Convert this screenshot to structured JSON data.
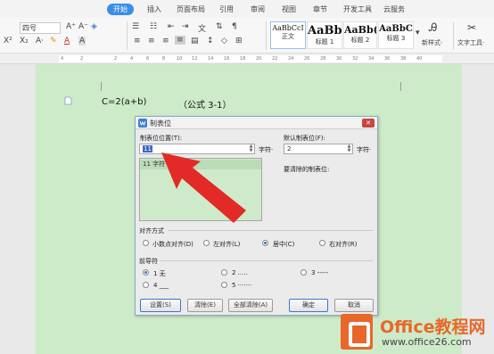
{
  "tabs": {
    "home": "开始",
    "insert": "插入",
    "layout": "页面布局",
    "references": "引用",
    "review": "审阅",
    "view": "视图",
    "section": "章节",
    "developer": "开发工具",
    "cloud": "云服务"
  },
  "ribbon": {
    "font_size": "四号",
    "styles": [
      {
        "preview": "AaBbCcI",
        "name": "正文"
      },
      {
        "preview": "AaBb",
        "name": "标题 1"
      },
      {
        "preview": "AaBb(",
        "name": "标题 2"
      },
      {
        "preview": "AaBbC",
        "name": "标题 3"
      }
    ],
    "new_style": "新样式·",
    "text_tools": "文字工具·"
  },
  "ruler": {
    "marks": [
      "4",
      "2",
      "2",
      "4",
      "6",
      "8",
      "10",
      "12",
      "14",
      "16",
      "18",
      "20",
      "22",
      "24",
      "26",
      "28",
      "30",
      "32",
      "34",
      "36",
      "38",
      "40"
    ]
  },
  "document": {
    "formula": "C=2(a+b)",
    "formula_label": "（公式 3-1）"
  },
  "dialog": {
    "title": "制表位",
    "tab_position_label": "制表位位置(T):",
    "tab_position_value": "11",
    "tab_position_unit": "字符·",
    "list_item": "11 字符",
    "default_tab_label": "默认制表位(F):",
    "default_tab_value": "2",
    "default_tab_unit": "字符·",
    "to_clear_label": "要清除的制表位:",
    "alignment_group": "对齐方式",
    "alignment_options": [
      "小数点对齐(D)",
      "左对齐(L)",
      "居中(C)",
      "右对齐(R)"
    ],
    "alignment_selected": "居中(C)",
    "leader_group": "前导符",
    "leader_options": [
      "1 无",
      "2 .....",
      "3 -----",
      "4 ___",
      "5 ·······"
    ],
    "leader_selected": "1 无",
    "buttons": {
      "set": "设置(S)",
      "clear": "清除(E)",
      "clear_all": "全部清除(A)",
      "ok": "确定",
      "cancel": "取消"
    }
  },
  "watermark": {
    "name": "Office教程网",
    "url": "www.office26.com"
  }
}
